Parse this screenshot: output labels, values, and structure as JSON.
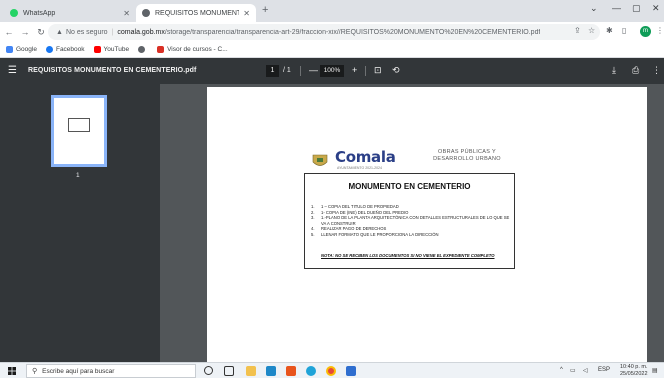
{
  "browser": {
    "tabs": [
      {
        "title": "WhatsApp",
        "active": false,
        "favicon_color": "#25d366"
      },
      {
        "title": "REQUISITOS MONUMENTO EN C",
        "active": true,
        "favicon_color": "#5f6368"
      }
    ],
    "new_tab_label": "+",
    "address": {
      "security_label": "No es seguro",
      "domain": "comala.gob.mx",
      "path": "/storage/transparencia/transparencia-art-29/fraccion-xix//REQUISITOS%20MONUMENTO%20EN%20CEMENTERIO.pdf"
    },
    "profile_initial": "m",
    "bookmarks": [
      {
        "label": "Google",
        "color": "#4285f4"
      },
      {
        "label": "Facebook",
        "color": "#1877f2"
      },
      {
        "label": "YouTube",
        "color": "#ff0000"
      },
      {
        "label": "",
        "color": "#5f6368"
      },
      {
        "label": "Visor de cursos - C...",
        "color": "#d93025"
      }
    ]
  },
  "pdf_viewer": {
    "title": "REQUISITOS MONUMENTO EN CEMENTERIO.pdf",
    "current_page": "1",
    "total_pages": "/ 1",
    "zoom": "100%",
    "thumbnail_page_number": "1"
  },
  "document": {
    "logo_name": "Comala",
    "logo_subtitle": "AYUNTAMIENTO 2021-2024",
    "department": "OBRAS PÚBLICAS Y DESARROLLO URBANO",
    "heading": "MONUMENTO EN CEMENTERIO",
    "requirements": [
      {
        "num": "1.",
        "text": "1 – COPIA DEL TITULO DE PROPIEDAD"
      },
      {
        "num": "2.",
        "text": "1- COPIA DE (INE) DEL DUEÑO DEL PREDIO"
      },
      {
        "num": "3.",
        "text": "1.-PLANO DE LA PLANTA ARQUITECTÓNICA CON DETALLES ESTRUCTURALES DE LO QUE SE VA A CONSTRUIR"
      },
      {
        "num": "4.",
        "text": "REALIZAR PAGO DE DERECHOS"
      },
      {
        "num": "5.",
        "text": "LLENAR FORMATO QUE LE PROPORCIONA LA DIRECCIÓN"
      }
    ],
    "note": "NOTA: NO SE RECIBEN LOS DOCUMENTOS SI NO VIENE EL EXPEDIENTE COMPLETO"
  },
  "taskbar": {
    "search_placeholder": "Escribe aquí para buscar",
    "language": "ESP",
    "time": "10:40 p. m.",
    "date": "25/05/2022"
  }
}
